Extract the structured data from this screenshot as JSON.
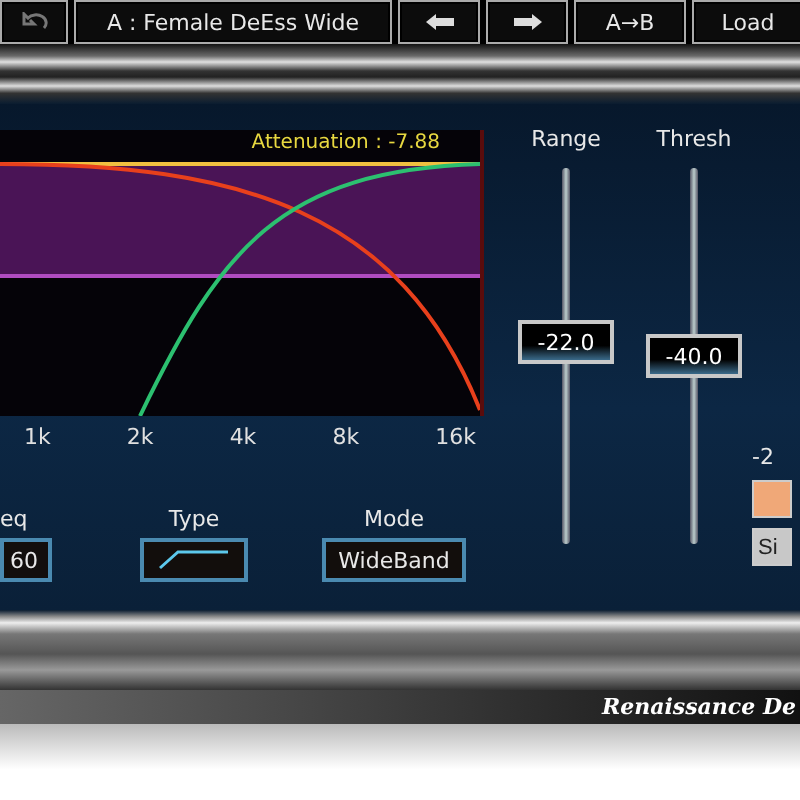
{
  "toolbar": {
    "preset": "A : Female DeEss Wide",
    "compare": "A→B",
    "load": "Load"
  },
  "graph": {
    "attenuation": "Attenuation : -7.88",
    "x_labels": [
      "1k",
      "2k",
      "4k",
      "8k",
      "16k"
    ]
  },
  "controls": [
    {
      "kind": "value",
      "label": "eq",
      "value": "60"
    },
    {
      "kind": "curve",
      "label": "Type"
    },
    {
      "kind": "value",
      "label": "Mode",
      "value": "WideBand"
    }
  ],
  "sliders": [
    {
      "label": "Range",
      "value": "-22.0",
      "level": 0.54
    },
    {
      "label": "Thresh",
      "value": "-40.0",
      "level": 0.5
    }
  ],
  "side": {
    "reading": "-2",
    "buttons": [
      {
        "selected": true
      },
      {
        "label": "Si",
        "selected": false
      }
    ]
  },
  "nameplate": "Renaissance De"
}
